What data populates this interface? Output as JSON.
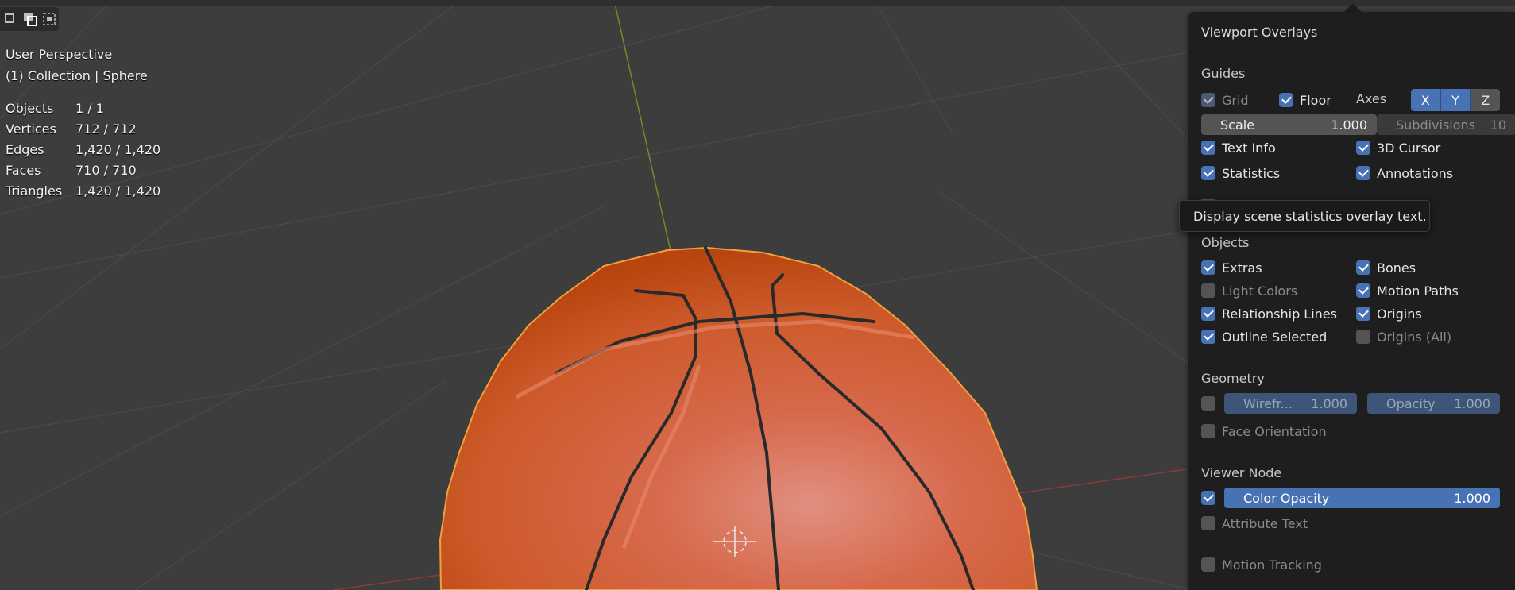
{
  "viewport": {
    "view_name": "User Perspective",
    "collection_object": "(1) Collection | Sphere",
    "stats": [
      {
        "label": "Objects",
        "value": "1 / 1"
      },
      {
        "label": "Vertices",
        "value": "712 / 712"
      },
      {
        "label": "Edges",
        "value": "1,420 / 1,420"
      },
      {
        "label": "Faces",
        "value": "710 / 710"
      },
      {
        "label": "Triangles",
        "value": "1,420 / 1,420"
      }
    ]
  },
  "overlays": {
    "title": "Viewport Overlays",
    "guides": {
      "heading": "Guides",
      "grid": {
        "label": "Grid",
        "checked": true,
        "enabled": false
      },
      "floor": {
        "label": "Floor",
        "checked": true
      },
      "axes_label": "Axes",
      "axes": [
        {
          "label": "X",
          "on": true
        },
        {
          "label": "Y",
          "on": true
        },
        {
          "label": "Z",
          "on": false
        }
      ],
      "scale": {
        "label": "Scale",
        "value": "1.000"
      },
      "subdivisions": {
        "label": "Subdivisions",
        "value": "10"
      },
      "text_info": {
        "label": "Text Info",
        "checked": true
      },
      "cursor_3d": {
        "label": "3D Cursor",
        "checked": true
      },
      "statistics": {
        "label": "Statistics",
        "checked": true
      },
      "annotations": {
        "label": "Annotations",
        "checked": true
      }
    },
    "objects": {
      "heading": "Objects",
      "extras": {
        "label": "Extras",
        "checked": true
      },
      "bones": {
        "label": "Bones",
        "checked": true
      },
      "light_colors": {
        "label": "Light Colors",
        "checked": false
      },
      "motion_paths": {
        "label": "Motion Paths",
        "checked": true
      },
      "relationship_lines": {
        "label": "Relationship Lines",
        "checked": true
      },
      "origins": {
        "label": "Origins",
        "checked": true
      },
      "outline_selected": {
        "label": "Outline Selected",
        "checked": true
      },
      "origins_all": {
        "label": "Origins (All)",
        "checked": false
      }
    },
    "geometry": {
      "heading": "Geometry",
      "wireframe": {
        "label": "Wirefr...",
        "value": "1.000",
        "checked": false
      },
      "opacity": {
        "label": "Opacity",
        "value": "1.000"
      },
      "face_orientation": {
        "label": "Face Orientation",
        "checked": false
      }
    },
    "viewer_node": {
      "heading": "Viewer Node",
      "color_opacity": {
        "label": "Color Opacity",
        "value": "1.000",
        "checked": true
      },
      "attribute_text": {
        "label": "Attribute Text",
        "checked": false
      }
    },
    "motion_tracking": {
      "label": "Motion Tracking",
      "checked": false
    }
  },
  "tooltip": {
    "text": "Display scene statistics overlay text."
  },
  "colors": {
    "accent": "#4772b3",
    "panel_bg": "#1e1e1e",
    "viewport_bg": "#3d3d3d",
    "ball": "#d5582a"
  }
}
